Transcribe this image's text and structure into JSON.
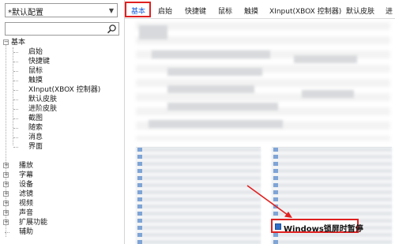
{
  "profile": {
    "selected": "*默认配置"
  },
  "search": {
    "value": ""
  },
  "tree": {
    "root": "基本",
    "children": [
      "启始",
      "快捷键",
      "鼠标",
      "触摸",
      "XInput(XBOX 控制器)",
      "默认皮肤",
      "进阶皮肤",
      "截图",
      "随索",
      "消息",
      "界面"
    ],
    "groups": [
      "播放",
      "字幕",
      "设备",
      "滤镜",
      "视频",
      "声音",
      "扩展功能",
      "辅助"
    ]
  },
  "tabs": [
    "基本",
    "启始",
    "快捷键",
    "鼠标",
    "触摸",
    "XInput(XBOX 控制器)",
    "默认皮肤",
    "进"
  ],
  "highlight": {
    "label": "Windows锁屏时暂停",
    "checked": true
  },
  "colors": {
    "annotation": "#e02020",
    "active_tab_text": "#1e5fd8",
    "checkbox": "#2f6ec8"
  }
}
